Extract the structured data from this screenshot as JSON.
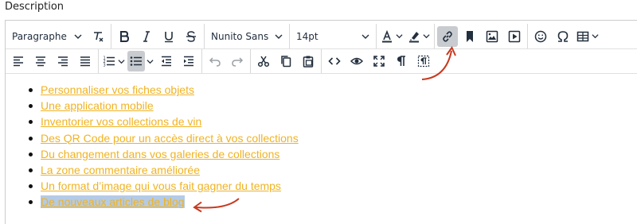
{
  "field": {
    "label": "Description"
  },
  "toolbar": {
    "format_select": "Paragraphe",
    "font_select": "Nunito Sans",
    "size_select": "14pt"
  },
  "content": {
    "items": [
      "Personnaliser vos fiches objets",
      "Une application mobile",
      "Inventorier vos collections de vin ",
      "Des QR Code pour un accès direct à vos collections",
      "Du changement dans vos galeries de collections",
      "La zone commentaire améliorée ",
      "Un format d’image qui vous fait gagner du temps",
      "De nouveaux articles de blog"
    ]
  },
  "colors": {
    "link": "#f0b323",
    "selection": "#b4cbe6",
    "annotation_arrow": "#c8391f",
    "active_button": "#c8cbcf"
  },
  "state": {
    "active_buttons": [
      "insert-link",
      "bullet-list"
    ],
    "selected_item_index": 7
  }
}
